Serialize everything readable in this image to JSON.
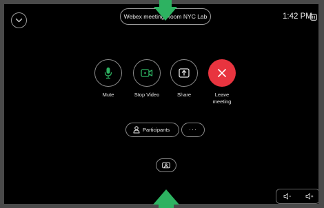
{
  "header": {
    "meeting_title": "Webex meeting Room NYC Lab",
    "clock": "1:42 PM"
  },
  "controls": {
    "mute_label": "Mute",
    "stop_video_label": "Stop Video",
    "share_label": "Share",
    "leave_label": "Leave meeting"
  },
  "secondary": {
    "participants_label": "Participants",
    "more_label": "···"
  },
  "colors": {
    "leave": "#e8343f",
    "mic_active": "#2db261",
    "arrow_annotation": "#2db261",
    "background": "#000000"
  },
  "icons": {
    "top_left": "chevron-down-icon",
    "mute": "microphone-icon",
    "video": "video-camera-icon",
    "share": "share-up-arrow-icon",
    "leave": "close-x-icon",
    "participants": "person-icon",
    "selfview": "self-view-icon",
    "volume_down": "speaker-low-icon",
    "volume_up": "speaker-high-icon"
  }
}
